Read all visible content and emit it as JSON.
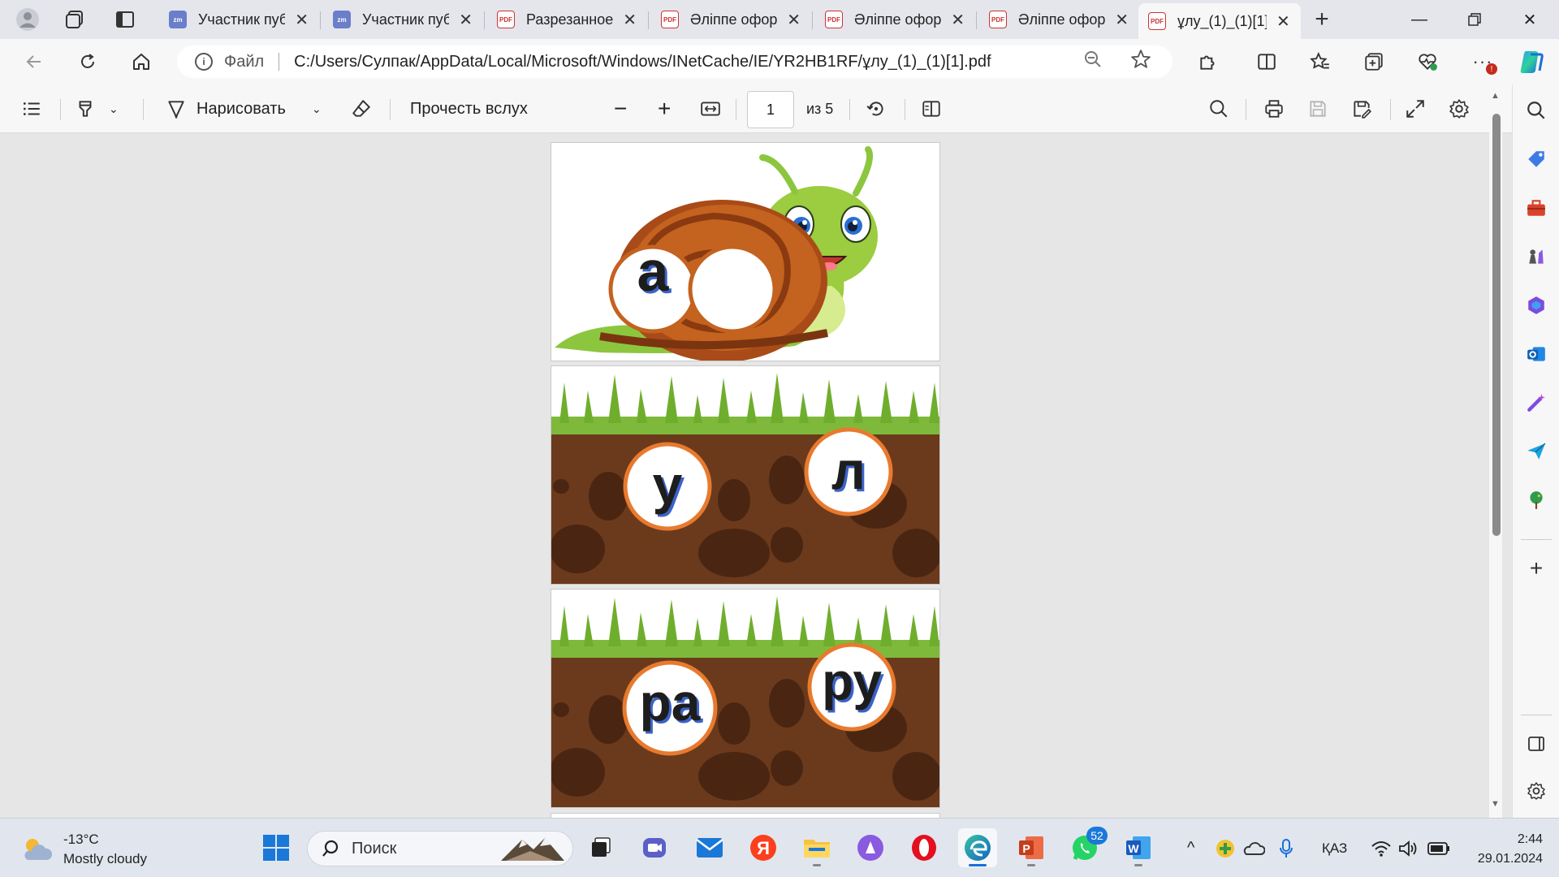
{
  "tabs": [
    {
      "label": "Участник пуб",
      "icon": "zoom-icon"
    },
    {
      "label": "Участник пуб",
      "icon": "zoom-icon"
    },
    {
      "label": "Разрезанное",
      "icon": "pdf-icon"
    },
    {
      "label": "Әліппе офор",
      "icon": "pdf-icon"
    },
    {
      "label": "Әліппе офор",
      "icon": "pdf-icon"
    },
    {
      "label": "Әліппе офор",
      "icon": "pdf-icon"
    },
    {
      "label": "ұлу_(1)_(1)[1]",
      "icon": "pdf-icon",
      "active": true
    }
  ],
  "address": {
    "scheme": "Файл",
    "url": "C:/Users/Сулпак/AppData/Local/Microsoft/Windows/INetCache/IE/YR2HB1RF/ұлу_(1)_(1)[1].pdf"
  },
  "pdf_toolbar": {
    "draw_label": "Нарисовать",
    "read_aloud_label": "Прочесть вслух",
    "page_current": "1",
    "page_total": "из 5"
  },
  "pages": {
    "p1": {
      "syllable_1": "а",
      "syllable_2": ""
    },
    "p2": {
      "syllable_1": "у",
      "syllable_2": "л"
    },
    "p3": {
      "syllable_1": "ра",
      "syllable_2": "ру"
    }
  },
  "taskbar": {
    "weather_temp": "-13°C",
    "weather_desc": "Mostly cloudy",
    "search_placeholder": "Поиск",
    "whatsapp_badge": "52",
    "lang": "ҚАЗ",
    "time": "2:44",
    "date": "29.01.2024"
  },
  "colors": {
    "accent": "#1a6fd8",
    "soil": "#6b3a1c",
    "grass": "#7fb93b",
    "circle_border": "#e87a2e",
    "snail_shell": "#b5571f",
    "snail_body": "#9ccc3f"
  }
}
